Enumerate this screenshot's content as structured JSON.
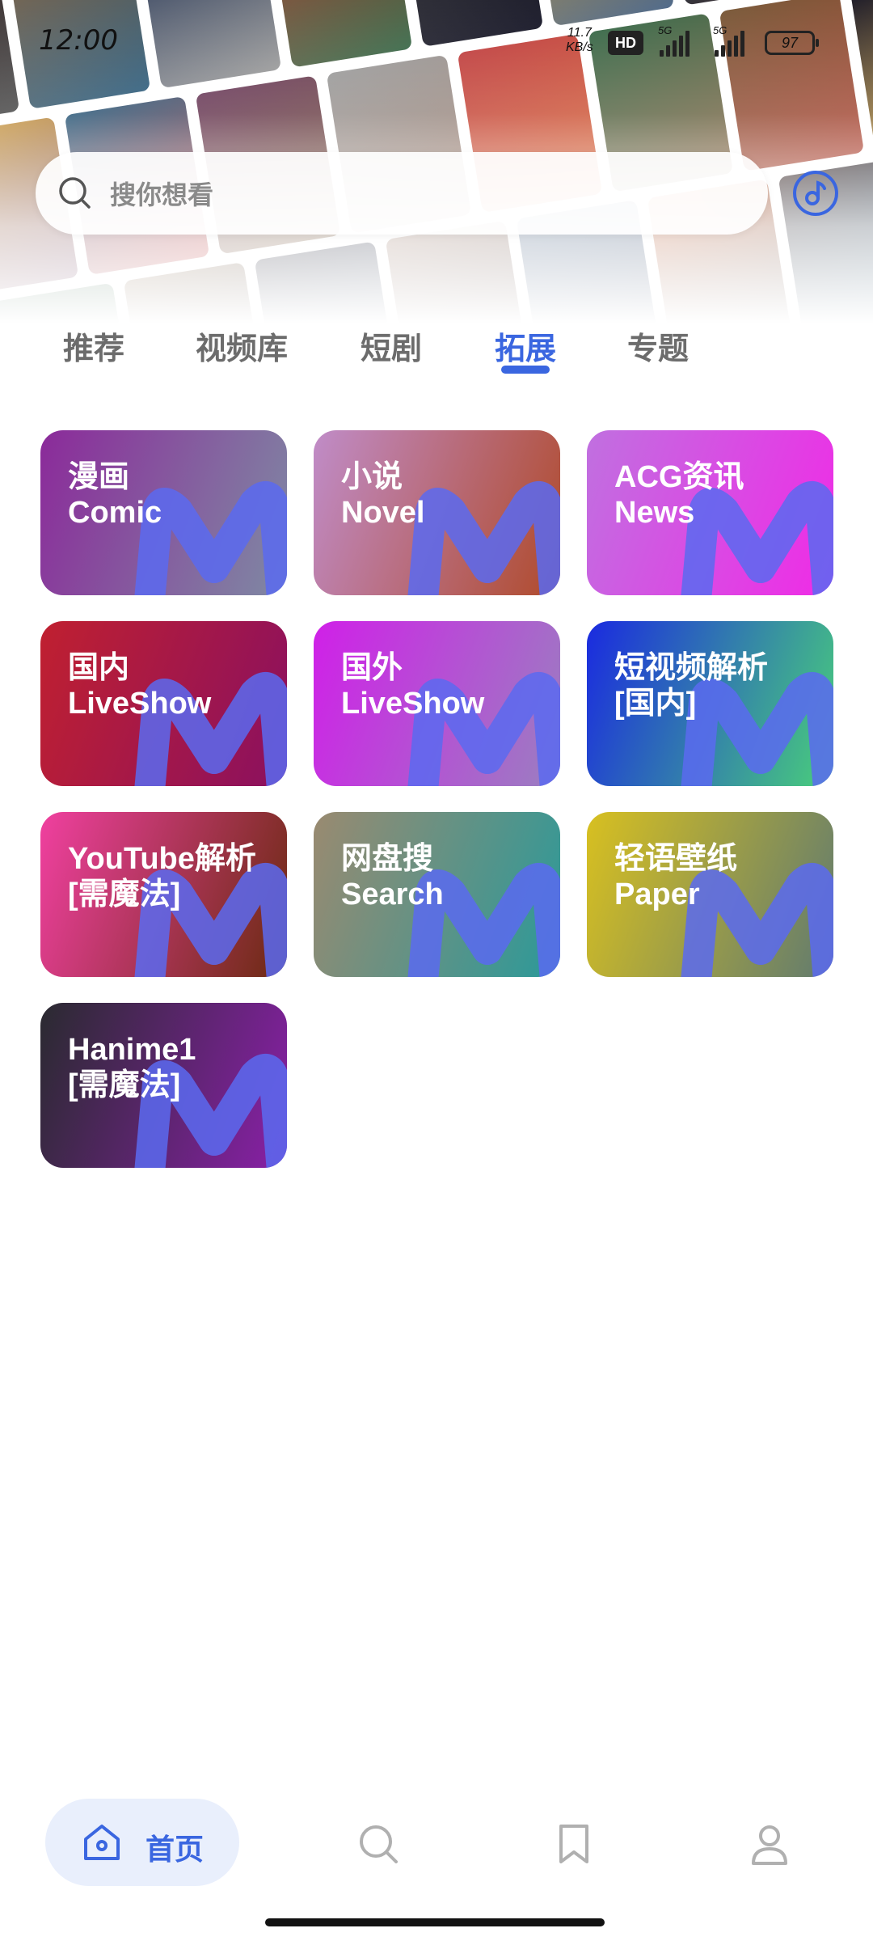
{
  "status_bar": {
    "time": "12:00",
    "speed": "11.7",
    "speed_unit": "KB/s",
    "hd": "HD",
    "signal1": "5G",
    "signal2": "5G",
    "battery": "97"
  },
  "search": {
    "placeholder": "搜你想看",
    "icon": "search-icon"
  },
  "header": {
    "cast_icon": "music-disc-icon"
  },
  "tabs": [
    {
      "label": "推荐",
      "active": false
    },
    {
      "label": "视频库",
      "active": false
    },
    {
      "label": "短剧",
      "active": false
    },
    {
      "label": "拓展",
      "active": true
    },
    {
      "label": "专题",
      "active": false
    }
  ],
  "cards": [
    {
      "line1": "漫画",
      "line2": "Comic",
      "colors": [
        "#8b2a9a",
        "#7f8aa3"
      ]
    },
    {
      "line1": "小说",
      "line2": "Novel",
      "colors": [
        "#c08cc8",
        "#b04a2a"
      ]
    },
    {
      "line1": "ACG资讯",
      "line2": "News",
      "colors": [
        "#c070e0",
        "#f02ae6"
      ]
    },
    {
      "line1": "国内",
      "line2": "LiveShow",
      "colors": [
        "#c02030",
        "#8a1060"
      ]
    },
    {
      "line1": "国外",
      "line2": "LiveShow",
      "colors": [
        "#d020e8",
        "#9a80c0"
      ]
    },
    {
      "line1": "短视频解析",
      "line2": "[国内]",
      "colors": [
        "#1a2ae0",
        "#4ad07a"
      ]
    },
    {
      "line1": "YouTube解析",
      "line2": "[需魔法]",
      "colors": [
        "#f040a0",
        "#6a2a10"
      ]
    },
    {
      "line1": "网盘搜",
      "line2": "Search",
      "colors": [
        "#9a8a70",
        "#2a9a9a"
      ]
    },
    {
      "line1": "轻语壁纸",
      "line2": "Paper",
      "colors": [
        "#d8c020",
        "#607a70"
      ]
    },
    {
      "line1": "Hanime1",
      "line2": "[需魔法]",
      "colors": [
        "#2a2a30",
        "#8a20a8"
      ]
    }
  ],
  "bottom_nav": {
    "home_label": "首页",
    "items": [
      "home-icon",
      "search-icon",
      "bookmark-icon",
      "profile-icon"
    ]
  },
  "poster_colors": [
    "#3a2a2a",
    "#8a6a4a",
    "#2a3a5a",
    "#b04a3a",
    "#4a4a4a",
    "#d0a040",
    "#2a5a7a",
    "#6a3a5a",
    "#9a9a9a",
    "#c04040",
    "#3a6a4a",
    "#7a5a3a",
    "#1a1a2a",
    "#a08070",
    "#506a8a",
    "#d86a3a"
  ]
}
